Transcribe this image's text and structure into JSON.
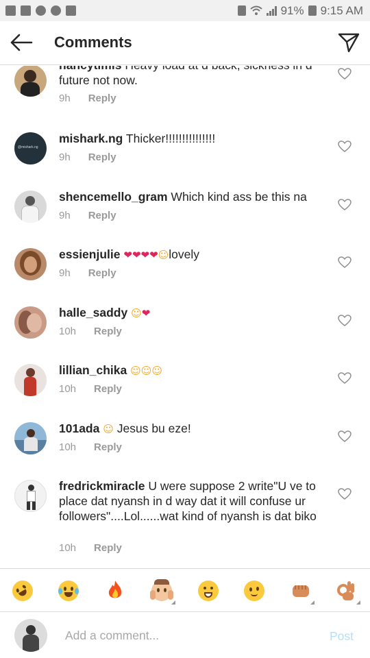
{
  "status_bar": {
    "battery": "91%",
    "time": "9:15 AM"
  },
  "header": {
    "title": "Comments"
  },
  "comments": [
    {
      "username": "nancytimis",
      "text": "Heavy load at d back, sickness in d future not now.",
      "time": "9h",
      "reply": "Reply"
    },
    {
      "username": "mishark.ng",
      "text": "Thicker!!!!!!!!!!!!!!!",
      "time": "9h",
      "reply": "Reply",
      "avatar_text": "@mishark.ng"
    },
    {
      "username": "shencemello_gram",
      "text": "Which kind ass be this na",
      "time": "9h",
      "reply": "Reply"
    },
    {
      "username": "essienjulie",
      "emoji": "❤❤❤❤",
      "emoji2": "☺",
      "text": "lovely",
      "time": "9h",
      "reply": "Reply"
    },
    {
      "username": "halle_saddy",
      "emoji": "☺",
      "emoji2": "❤",
      "text": "",
      "time": "10h",
      "reply": "Reply"
    },
    {
      "username": "lillian_chika",
      "emoji": "☺☺☺",
      "text": "",
      "time": "10h",
      "reply": "Reply"
    },
    {
      "username": "101ada",
      "emoji": "☺",
      "text": "Jesus bu eze!",
      "time": "10h",
      "reply": "Reply"
    },
    {
      "username": "fredrickmiracle",
      "text": "U were suppose 2 write\"U ve to place dat nyansh in d way dat it will confuse ur followers\"....Lol......wat kind of nyansh is dat biko",
      "time": "10h",
      "reply": "Reply"
    }
  ],
  "emoji_bar": [
    "rolling-on-floor-laughing",
    "tears-of-joy",
    "fire",
    "face-with-hands",
    "grinning",
    "woozy",
    "fist",
    "ok-hand"
  ],
  "input": {
    "placeholder": "Add a comment...",
    "post_label": "Post"
  },
  "colors": {
    "text": "#262626",
    "meta": "#999999",
    "post_disabled": "#b2dffc",
    "heart_red": "#e0245e"
  }
}
